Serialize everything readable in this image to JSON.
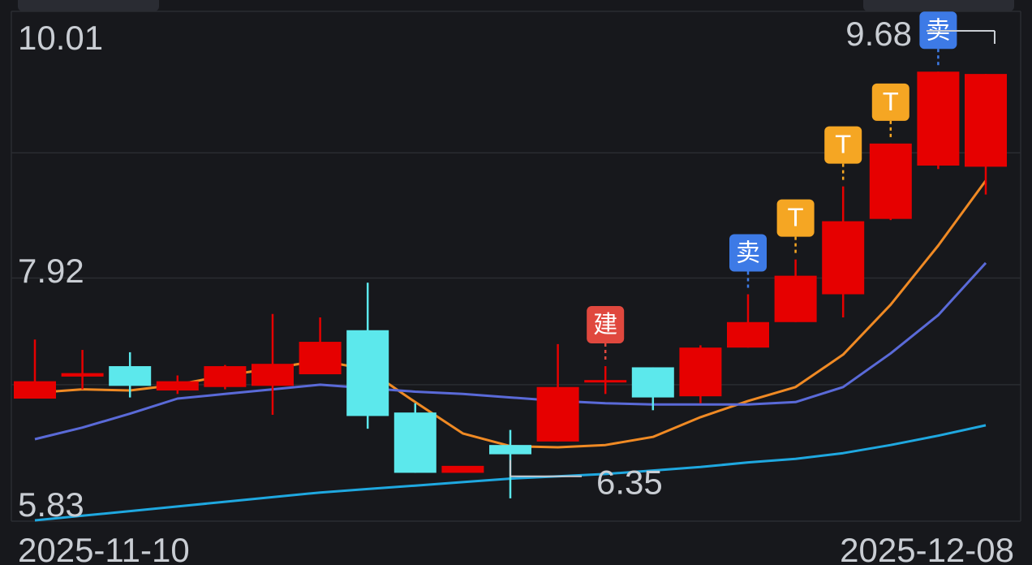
{
  "colors": {
    "up": "#e60000",
    "down": "#5ce8ec",
    "ma_orange": "#f08a24",
    "ma_purple": "#5a6ad8",
    "ma_blue": "#1fa8e0",
    "grid": "#2a2c31",
    "text": "#c9cdd3",
    "sig_sell": "#3d7ae6",
    "sig_t": "#f5a623",
    "sig_build": "#e0483e"
  },
  "chart_data": {
    "type": "candlestick",
    "x_labels": {
      "start": "2025-11-10",
      "end": "2025-12-08"
    },
    "ylim": [
      5.83,
      10.01
    ],
    "y_ticks": [
      "10.01",
      "7.92",
      "5.83"
    ],
    "candles": [
      {
        "open": 6.88,
        "close": 7.03,
        "high": 7.39,
        "low": 6.88
      },
      {
        "open": 7.07,
        "close": 7.1,
        "high": 7.3,
        "low": 6.96
      },
      {
        "open": 7.16,
        "close": 6.99,
        "high": 7.28,
        "low": 6.89
      },
      {
        "open": 6.95,
        "close": 7.03,
        "high": 7.08,
        "low": 6.92
      },
      {
        "open": 6.98,
        "close": 7.16,
        "high": 7.17,
        "low": 6.96
      },
      {
        "open": 6.99,
        "close": 7.18,
        "high": 7.61,
        "low": 6.74
      },
      {
        "open": 7.09,
        "close": 7.37,
        "high": 7.58,
        "low": 7.09
      },
      {
        "open": 7.47,
        "close": 6.73,
        "high": 7.88,
        "low": 6.62
      },
      {
        "open": 6.76,
        "close": 6.24,
        "high": 6.84,
        "low": 6.24
      },
      {
        "open": 6.24,
        "close": 6.3,
        "high": 6.32,
        "low": 6.32
      },
      {
        "open": 6.48,
        "close": 6.4,
        "high": 6.61,
        "low": 6.02
      },
      {
        "open": 6.51,
        "close": 6.98,
        "high": 7.35,
        "low": 6.51
      },
      {
        "open": 7.04,
        "close": 7.04,
        "high": 7.16,
        "low": 6.92
      },
      {
        "open": 7.15,
        "close": 6.89,
        "high": 7.15,
        "low": 6.78
      },
      {
        "open": 6.9,
        "close": 7.32,
        "high": 7.34,
        "low": 6.84
      },
      {
        "open": 7.32,
        "close": 7.54,
        "high": 7.78,
        "low": 7.32
      },
      {
        "open": 7.54,
        "close": 7.94,
        "high": 8.08,
        "low": 7.54
      },
      {
        "open": 7.78,
        "close": 8.41,
        "high": 8.71,
        "low": 7.58
      },
      {
        "open": 8.43,
        "close": 9.08,
        "high": 9.08,
        "low": 8.42
      },
      {
        "open": 8.89,
        "close": 9.7,
        "high": 9.7,
        "low": 8.86
      },
      {
        "open": 8.88,
        "close": 9.68,
        "high": 9.68,
        "low": 8.64
      }
    ],
    "series": [
      {
        "values": [
          6.93,
          6.96,
          6.95,
          7.0,
          7.08,
          7.14,
          7.21,
          7.13,
          6.85,
          6.58,
          6.47,
          6.46,
          6.48,
          6.55,
          6.72,
          6.86,
          6.98,
          7.26,
          7.69,
          8.2,
          8.76
        ]
      },
      {
        "values": [
          6.53,
          6.63,
          6.75,
          6.88,
          6.92,
          6.96,
          7.0,
          6.97,
          6.94,
          6.92,
          6.89,
          6.86,
          6.84,
          6.83,
          6.83,
          6.83,
          6.85,
          6.98,
          7.27,
          7.6,
          8.05
        ]
      },
      {
        "values": [
          5.83,
          5.87,
          5.91,
          5.95,
          5.99,
          6.03,
          6.07,
          6.1,
          6.13,
          6.16,
          6.19,
          6.21,
          6.23,
          6.26,
          6.29,
          6.33,
          6.36,
          6.41,
          6.48,
          6.56,
          6.65
        ]
      }
    ],
    "signals": [
      {
        "index": 12,
        "label": "建",
        "kind": "build"
      },
      {
        "index": 15,
        "label": "卖",
        "kind": "sell"
      },
      {
        "index": 16,
        "label": "T",
        "kind": "t"
      },
      {
        "index": 17,
        "label": "T",
        "kind": "t"
      },
      {
        "index": 18,
        "label": "T",
        "kind": "t"
      },
      {
        "index": 19,
        "label": "卖",
        "kind": "sell"
      }
    ],
    "annotations": {
      "max": {
        "label": "9.68",
        "value": 9.68,
        "index": 20
      },
      "min": {
        "label": "6.35",
        "value": 6.21,
        "index": 10
      }
    }
  }
}
